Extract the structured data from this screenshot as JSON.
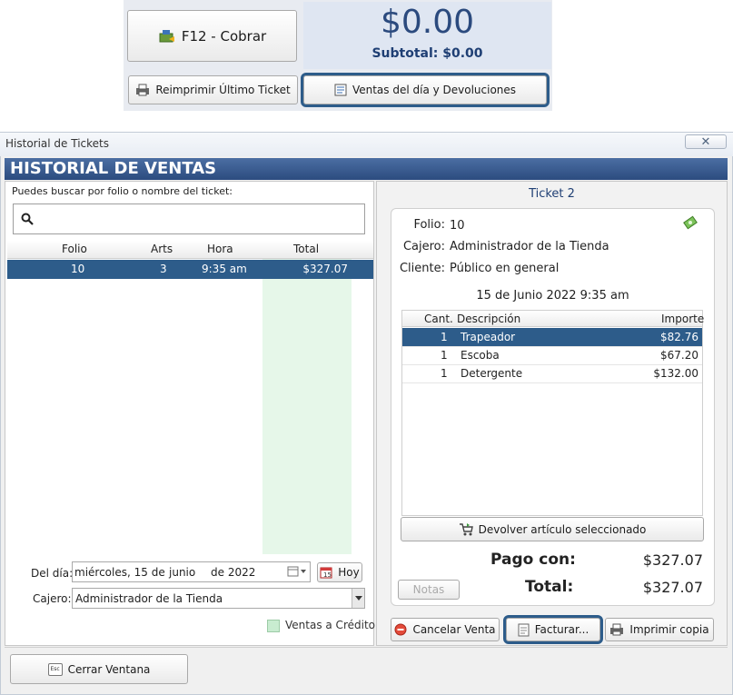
{
  "top": {
    "charge_button": "F12 - Cobrar",
    "total": "$0.00",
    "subtotal": "Subtotal: $0.00",
    "reprint_button": "Reimprimir Último Ticket",
    "sales_button": "Ventas del día y Devoluciones"
  },
  "window": {
    "title": "Historial de Tickets",
    "close": "✕",
    "header": "HISTORIAL DE VENTAS"
  },
  "search": {
    "label": "Puedes buscar por folio o nombre del ticket:",
    "value": ""
  },
  "tickets_grid": {
    "columns": [
      "Folio",
      "Arts",
      "Hora",
      "Total"
    ],
    "rows": [
      {
        "folio": "10",
        "arts": "3",
        "hora": "9:35 am",
        "total": "$327.07"
      }
    ]
  },
  "filters": {
    "day_label": "Del día:",
    "date_weekday": "miércoles, 15 de",
    "date_month": "junio",
    "date_year": "de 2022",
    "today_button": "Hoy",
    "cashier_label": "Cajero:",
    "cashier_value": "Administrador de la Tienda",
    "credit_legend": "Ventas a Crédito"
  },
  "ticket": {
    "title": "Ticket 2",
    "folio_label": "Folio:",
    "folio_value": "10",
    "cajero_label": "Cajero:",
    "cajero_value": "Administrador de la Tienda",
    "cliente_label": "Cliente:",
    "cliente_value": "Público en general",
    "datetime": "15 de Junio 2022 9:35 am",
    "items_columns": [
      "Cant.",
      "Descripción",
      "Importe"
    ],
    "items": [
      {
        "cant": "1",
        "desc": "Trapeador",
        "importe": "$82.76"
      },
      {
        "cant": "1",
        "desc": "Escoba",
        "importe": "$67.20"
      },
      {
        "cant": "1",
        "desc": "Detergente",
        "importe": "$132.00"
      }
    ],
    "return_button": "Devolver artículo seleccionado",
    "notes_button": "Notas",
    "pago_label": "Pago con:",
    "pago_value": "$327.07",
    "total_label": "Total:",
    "total_value": "$327.07"
  },
  "actions": {
    "cancel": "Cancelar Venta",
    "invoice": "Facturar...",
    "print_copy": "Imprimir copia",
    "close_window": "Cerrar Ventana",
    "esc_key": "Esc"
  },
  "colors": {
    "accent": "#2d5c8a",
    "header": "#3a5d93",
    "credit": "#c8ecd0"
  }
}
